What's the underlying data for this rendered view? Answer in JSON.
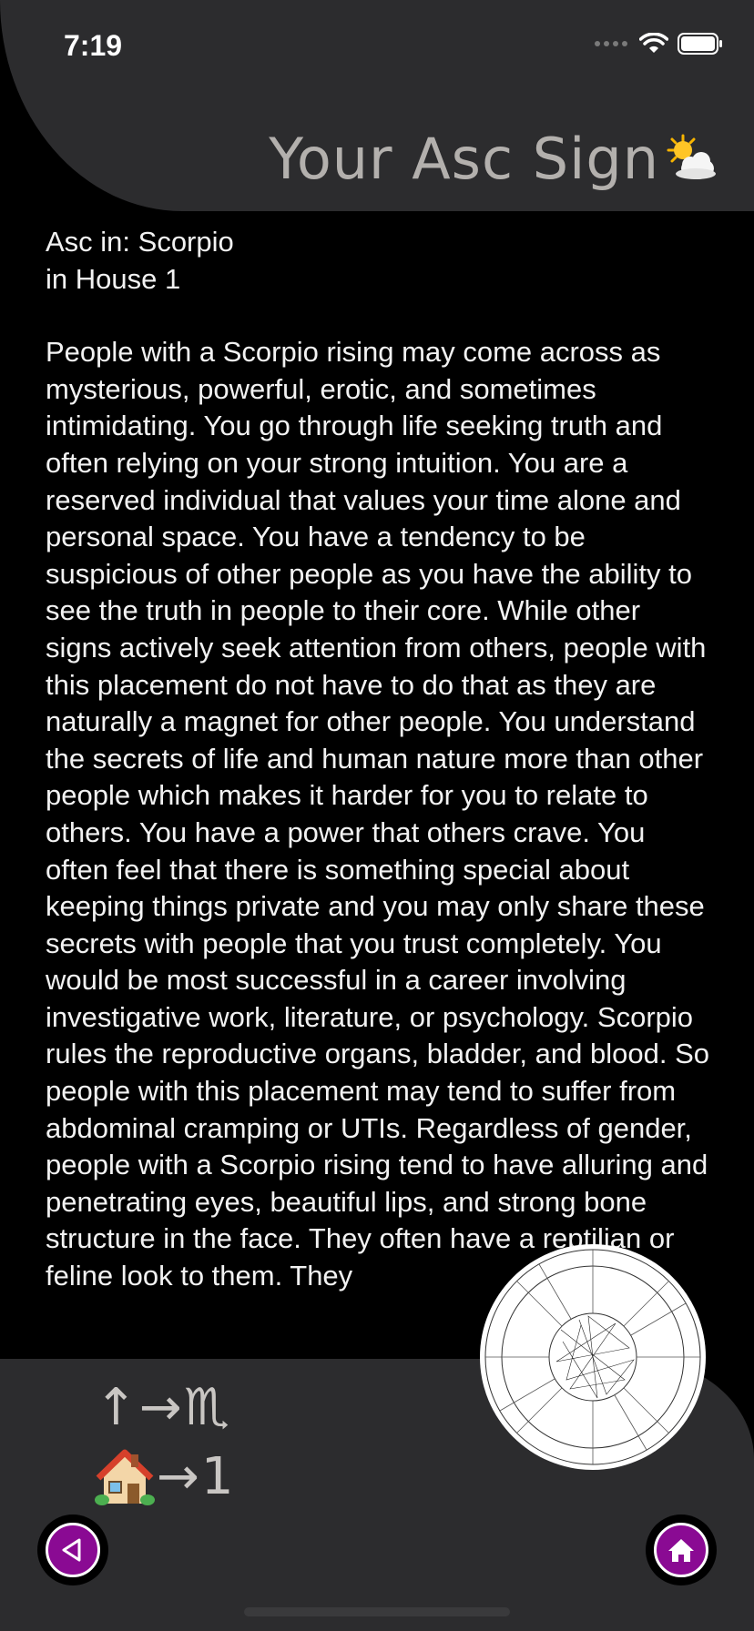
{
  "status_bar": {
    "time": "7:19"
  },
  "header": {
    "title": "Your Asc Sign"
  },
  "content": {
    "line1": "Asc in: Scorpio",
    "line2": "in House 1",
    "body": "People with a Scorpio rising may come across as mysterious, powerful, erotic, and sometimes intimidating. You go through life seeking truth and often relying on your strong intuition. You are a reserved individual that values your time alone and personal space. You have a tendency to be suspicious of other people as you have the ability to see the truth in people to their core. While other signs actively seek attention from others, people with this placement do not have to do that as they are naturally a magnet for other people. You understand the secrets of life and human nature more than other people which makes it harder for you to relate to others. You have a power that others crave. You often feel that there is something special about keeping things private and you may only share these secrets with people that you trust completely. You would be most successful in a career involving investigative work, literature, or psychology. Scorpio rules the reproductive organs, bladder, and blood. So people with this placement may tend to suffer from abdominal cramping or UTIs. Regardless of gender, people with a Scorpio rising tend to have alluring and penetrating eyes, beautiful lips, and strong bone structure in the face. They often have a reptilian or feline look to them. They"
  },
  "legend": {
    "asc_symbol": "↑",
    "arrow": "→",
    "sign_glyph": "♏",
    "house_emoji": "🏠",
    "house_number": "1"
  },
  "nav": {
    "back": "back-triangle-icon",
    "home": "home-icon"
  },
  "colors": {
    "accent": "#8a0a93",
    "panel": "#2c2c2e",
    "title": "#b3b0ad"
  }
}
